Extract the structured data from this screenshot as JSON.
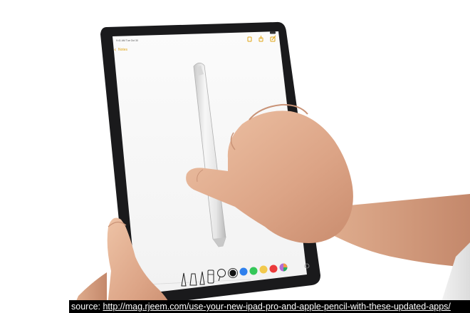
{
  "photo": {
    "subject": "ipad-pro-with-apple-pencil",
    "notes_app": {
      "back_label": "Notes",
      "status_time": "9:41 AM Tue Oct 30",
      "toolbar_icons": [
        "trash-icon",
        "share-icon",
        "compose-icon"
      ],
      "markup_tools": [
        "pen-icon",
        "marker-icon",
        "pencil-icon",
        "eraser-icon",
        "lasso-icon"
      ],
      "palette_colors": [
        "#111111",
        "#2f80ed",
        "#34c759",
        "#f2c94c",
        "#eb3b3b",
        "#b36bd6"
      ]
    }
  },
  "caption": {
    "prefix": "source: ",
    "url": "http://mag.rjeem.com/use-your-new-ipad-pro-and-apple-pencil-with-these-updated-apps/"
  }
}
